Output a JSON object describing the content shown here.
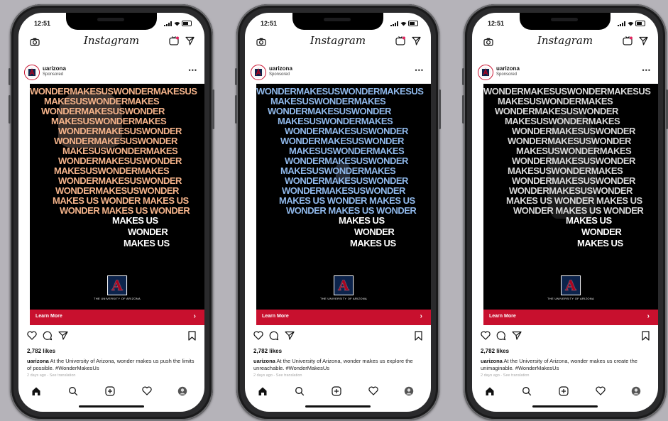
{
  "phones": [
    {
      "status_time": "12:51",
      "app_title": "Instagram",
      "username": "uarizona",
      "sponsored_label": "Sponsored",
      "cta_label": "Learn More",
      "likes": "2,782 likes",
      "caption_user": "uarizona",
      "caption_text": "At the University of Arizona, wonder makes us push the limits of possible. #WonderMakesUs",
      "time_ago": "2 days ago - See translation",
      "ad_color": "#f4b38a",
      "ad_variant": "orange"
    },
    {
      "status_time": "12:51",
      "app_title": "Instagram",
      "username": "uarizona",
      "sponsored_label": "Sponsored",
      "cta_label": "Learn More",
      "likes": "2,782 likes",
      "caption_user": "uarizona",
      "caption_text": "At the University of Arizona, wonder makes us explore the unreachable. #WonderMakesUs",
      "time_ago": "2 days ago - See translation",
      "ad_color": "#8fb8ea",
      "ad_variant": "blue"
    },
    {
      "status_time": "12:51",
      "app_title": "Instagram",
      "username": "uarizona",
      "sponsored_label": "Sponsored",
      "cta_label": "Learn More",
      "likes": "2,782 likes",
      "caption_user": "uarizona",
      "caption_text": "At the University of Arizona, wonder makes us create the unimaginable. #WonderMakesUs",
      "time_ago": "2 days ago - See translation",
      "ad_color": "#d8d8d8",
      "ad_variant": "gray"
    }
  ],
  "ad_text": {
    "line_a": "WONDERMAKESUSWONDERMAKESUS",
    "line_b": "MAKESUSWONDERMAKES",
    "line_c": "WONDERMAKESUSWONDER",
    "line_d": "MAKES US WONDER MAKES US",
    "line_e": "WONDER MAKES US WONDER",
    "line_f": "MAKES US",
    "line_g": "WONDER",
    "line_h": "MAKES US",
    "logo_caption": "THE UNIVERSITY OF ARIZONA"
  },
  "colors": {
    "cta_red": "#c8102e",
    "ua_blue": "#0c234b",
    "ua_red": "#ab0520",
    "page_bg": "#b5b3b9"
  }
}
